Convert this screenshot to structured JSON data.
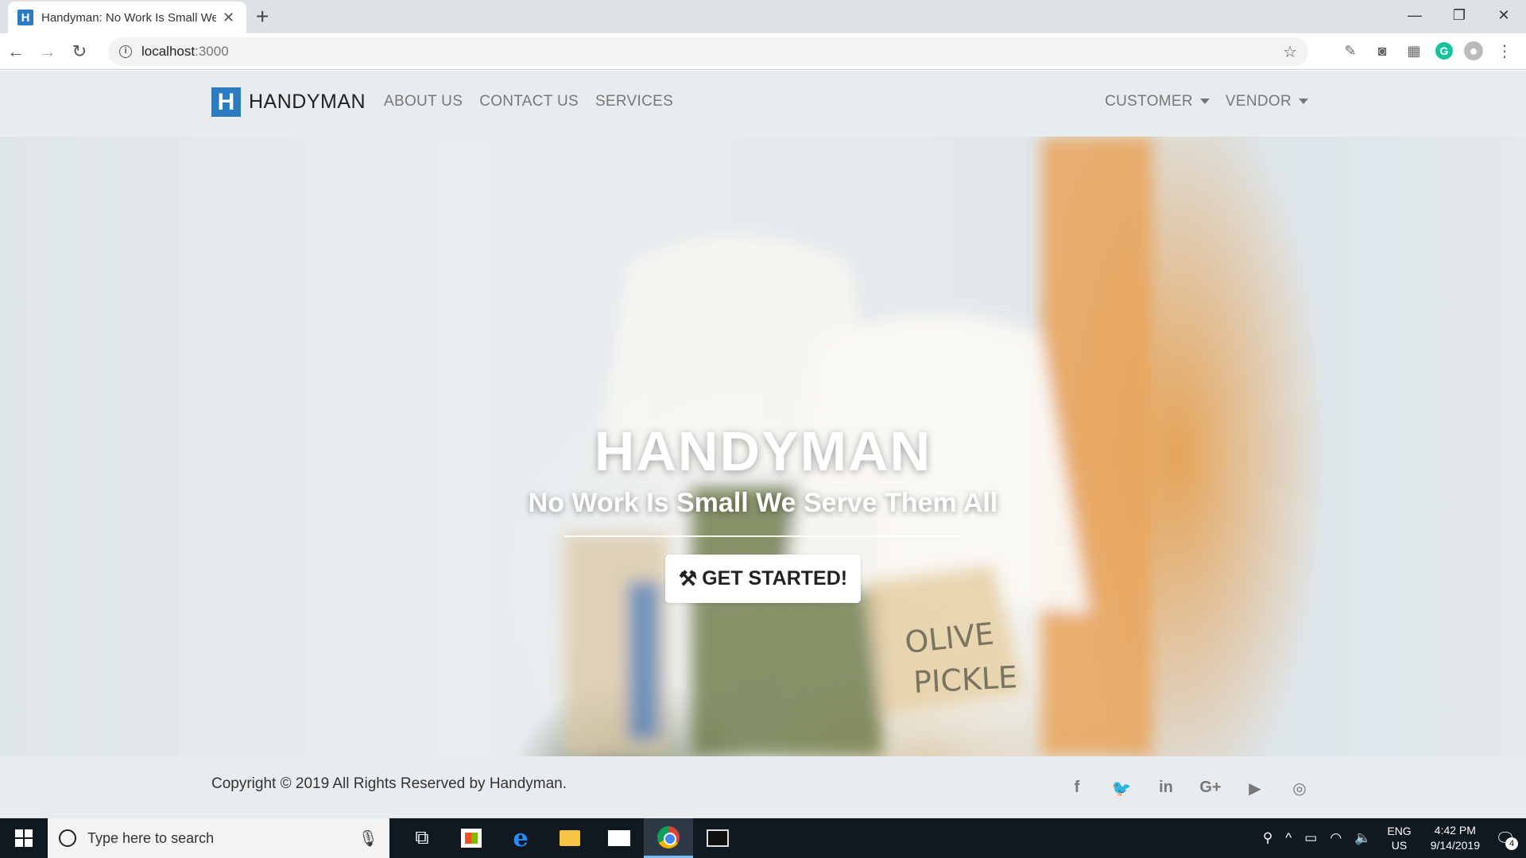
{
  "browser": {
    "tab_title": "Handyman: No Work Is Small We Serve Them All",
    "favicon_letter": "H",
    "new_tab": "+",
    "url_host": "localhost",
    "url_port": ":3000",
    "window_controls": {
      "minimize": "—",
      "restore": "❐",
      "close": "✕"
    }
  },
  "navbar": {
    "brand_letter": "H",
    "brand": "HANDYMAN",
    "links": [
      "ABOUT US",
      "CONTACT US",
      "SERVICES"
    ],
    "dropdowns": [
      "CUSTOMER",
      "VENDOR"
    ]
  },
  "hero": {
    "title": "HANDYMAN",
    "subtitle": "No Work Is Small We Serve Them All",
    "cta": "GET STARTED!"
  },
  "footer": {
    "copyright": "Copyright © 2019 All Rights Reserved by Handyman.",
    "socials": [
      {
        "icon": "facebook-icon",
        "glyph": "f"
      },
      {
        "icon": "twitter-icon",
        "glyph": "🐦"
      },
      {
        "icon": "linkedin-icon",
        "glyph": "in"
      },
      {
        "icon": "google-plus-icon",
        "glyph": "G+"
      },
      {
        "icon": "youtube-icon",
        "glyph": "▶"
      },
      {
        "icon": "instagram-icon",
        "glyph": "◎"
      }
    ]
  },
  "taskbar": {
    "search_placeholder": "Type here to search",
    "lang_top": "ENG",
    "lang_bottom": "US",
    "time": "4:42 PM",
    "date": "9/14/2019",
    "notification_count": "4"
  },
  "colors": {
    "brand_blue": "#2b7bc0",
    "navbar_bg": "#e9ecef",
    "taskbar_bg": "#101820"
  }
}
